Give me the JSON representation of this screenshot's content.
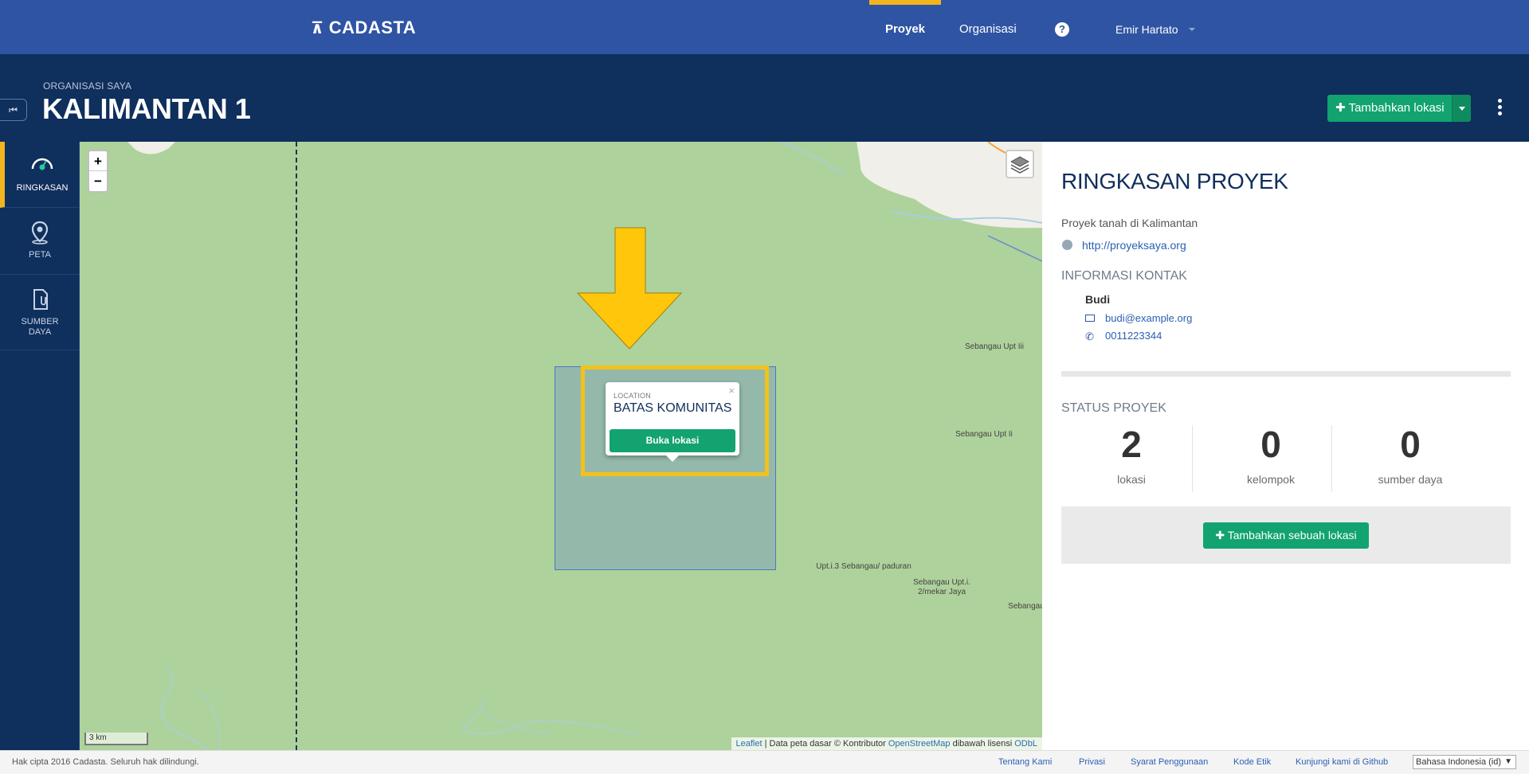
{
  "topnav": {
    "logo": "CADASTA",
    "nav_items": [
      "Proyek",
      "Organisasi"
    ],
    "help_label": "?",
    "user_name": "Emir Hartato"
  },
  "header": {
    "org_label": "ORGANISASI SAYA",
    "project_title": "KALIMANTAN 1",
    "add_location_label": "Tambahkan lokasi"
  },
  "sidebar": {
    "items": [
      {
        "label": "RINGKASAN",
        "icon": "dashboard-icon"
      },
      {
        "label": "PETA",
        "icon": "map-pin-icon"
      },
      {
        "label": "SUMBER DAYA",
        "icon": "resource-clip-icon"
      }
    ]
  },
  "map": {
    "zoom_in": "+",
    "zoom_out": "−",
    "popup": {
      "kicker": "LOCATION",
      "title": "BATAS KOMUNITAS",
      "button": "Buka lokasi",
      "close": "×"
    },
    "labels": [
      "Sebangau Upt Iii",
      "Sebangau Upt Ii",
      "Upt.i.3 Sebangau/ paduran",
      "Sebangau Upt.i. 2/mekar Jaya",
      "Sebangau"
    ],
    "scale": "3 km",
    "attribution": {
      "leaflet": "Leaflet",
      "text1": " | Data peta dasar © Kontributor ",
      "osm": "OpenStreetMap",
      "text2": " dibawah lisensi ",
      "odbl": "ODbL"
    },
    "highlight_color": "#f3c21a",
    "location_color": "#4a78c6"
  },
  "panel": {
    "title": "RINGKASAN PROYEK",
    "description": "Proyek tanah di Kalimantan",
    "url": "http://proyeksaya.org",
    "contact_heading": "INFORMASI KONTAK",
    "contact_name": "Budi",
    "contact_email": "budi@example.org",
    "contact_phone": "0011223344",
    "status_heading": "STATUS PROYEK",
    "stats": [
      {
        "value": "2",
        "label": "lokasi"
      },
      {
        "value": "0",
        "label": "kelompok"
      },
      {
        "value": "0",
        "label": "sumber daya"
      }
    ],
    "add_button": "Tambahkan sebuah lokasi"
  },
  "footer": {
    "copyright": "Hak cipta 2016 Cadasta. Seluruh hak dilindungi.",
    "links": [
      "Tentang Kami",
      "Privasi",
      "Syarat Penggunaan",
      "Kode Etik",
      "Kunjungi kami di Github"
    ],
    "language": "Bahasa Indonesia (id)"
  },
  "colors": {
    "nav_blue": "#2f54a3",
    "header_navy": "#0f2f5c",
    "accent_yellow": "#f2b51e",
    "action_green": "#12a370",
    "map_green": "#aed29b"
  }
}
